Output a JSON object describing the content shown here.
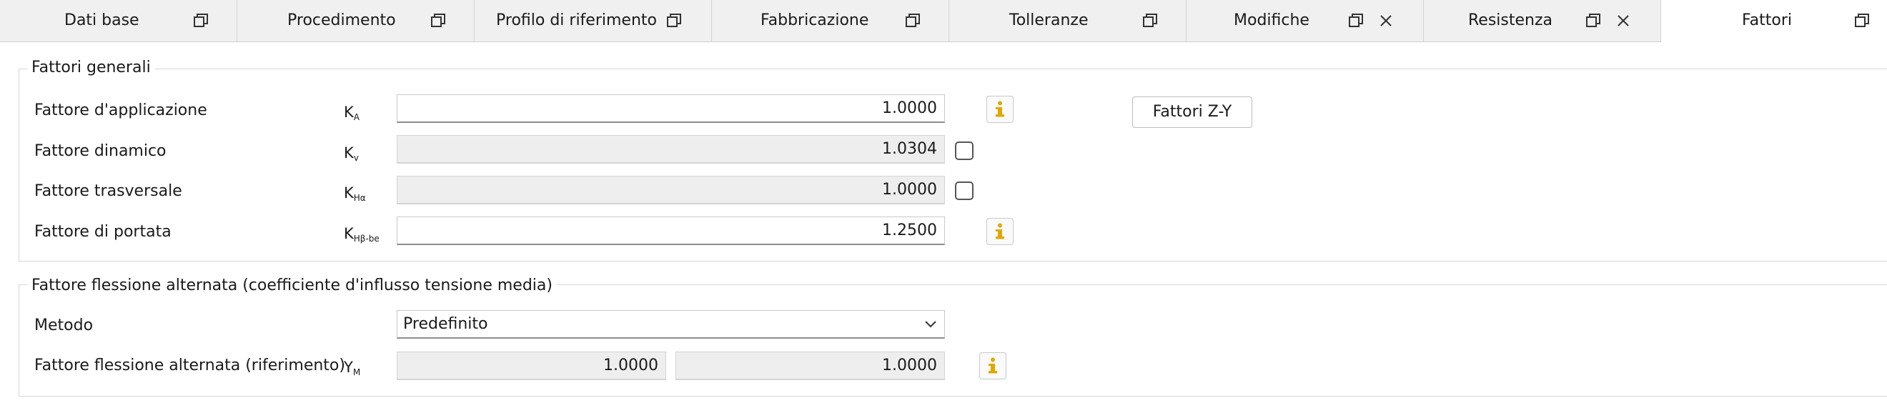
{
  "tabs": [
    {
      "label": "Dati base",
      "closable": false,
      "active": false
    },
    {
      "label": "Procedimento",
      "closable": false,
      "active": false
    },
    {
      "label": "Profilo di riferimento",
      "closable": false,
      "active": false
    },
    {
      "label": "Fabbricazione",
      "closable": false,
      "active": false
    },
    {
      "label": "Tolleranze",
      "closable": false,
      "active": false
    },
    {
      "label": "Modifiche",
      "closable": true,
      "active": false
    },
    {
      "label": "Resistenza",
      "closable": true,
      "active": false
    },
    {
      "label": "Fattori",
      "closable": false,
      "active": true
    }
  ],
  "general": {
    "title": "Fattori generali",
    "rows": [
      {
        "label": "Fattore d'applicazione",
        "sym": "K",
        "sub": "A",
        "value": "1.0000"
      },
      {
        "label": "Fattore dinamico",
        "sym": "K",
        "sub": "v",
        "value": "1.0304"
      },
      {
        "label": "Fattore trasversale",
        "sym": "K",
        "sub": "Hα",
        "value": "1.0000"
      },
      {
        "label": "Fattore di portata",
        "sym": "K",
        "sub": "Hβ-be",
        "value": "1.2500"
      }
    ],
    "zy_button": "Fattori Z-Y"
  },
  "alternating": {
    "title": "Fattore flessione alternata (coefficiente d'influsso tensione media)",
    "method_label": "Metodo",
    "method_value": "Predefinito",
    "ref_label": "Fattore flessione alternata (riferimento)",
    "ref_sym": "Y",
    "ref_sub": "M",
    "ref_value1": "1.0000",
    "ref_value2": "1.0000"
  },
  "colors": {
    "info_icon": "#e0a800",
    "tab_bg": "#f0f0f0",
    "field_readonly": "#eeeeee"
  },
  "icons": {
    "tab_float": "window-restore-icon",
    "tab_close": "close-icon",
    "info": "info-icon",
    "dropdown": "chevron-down-icon"
  }
}
